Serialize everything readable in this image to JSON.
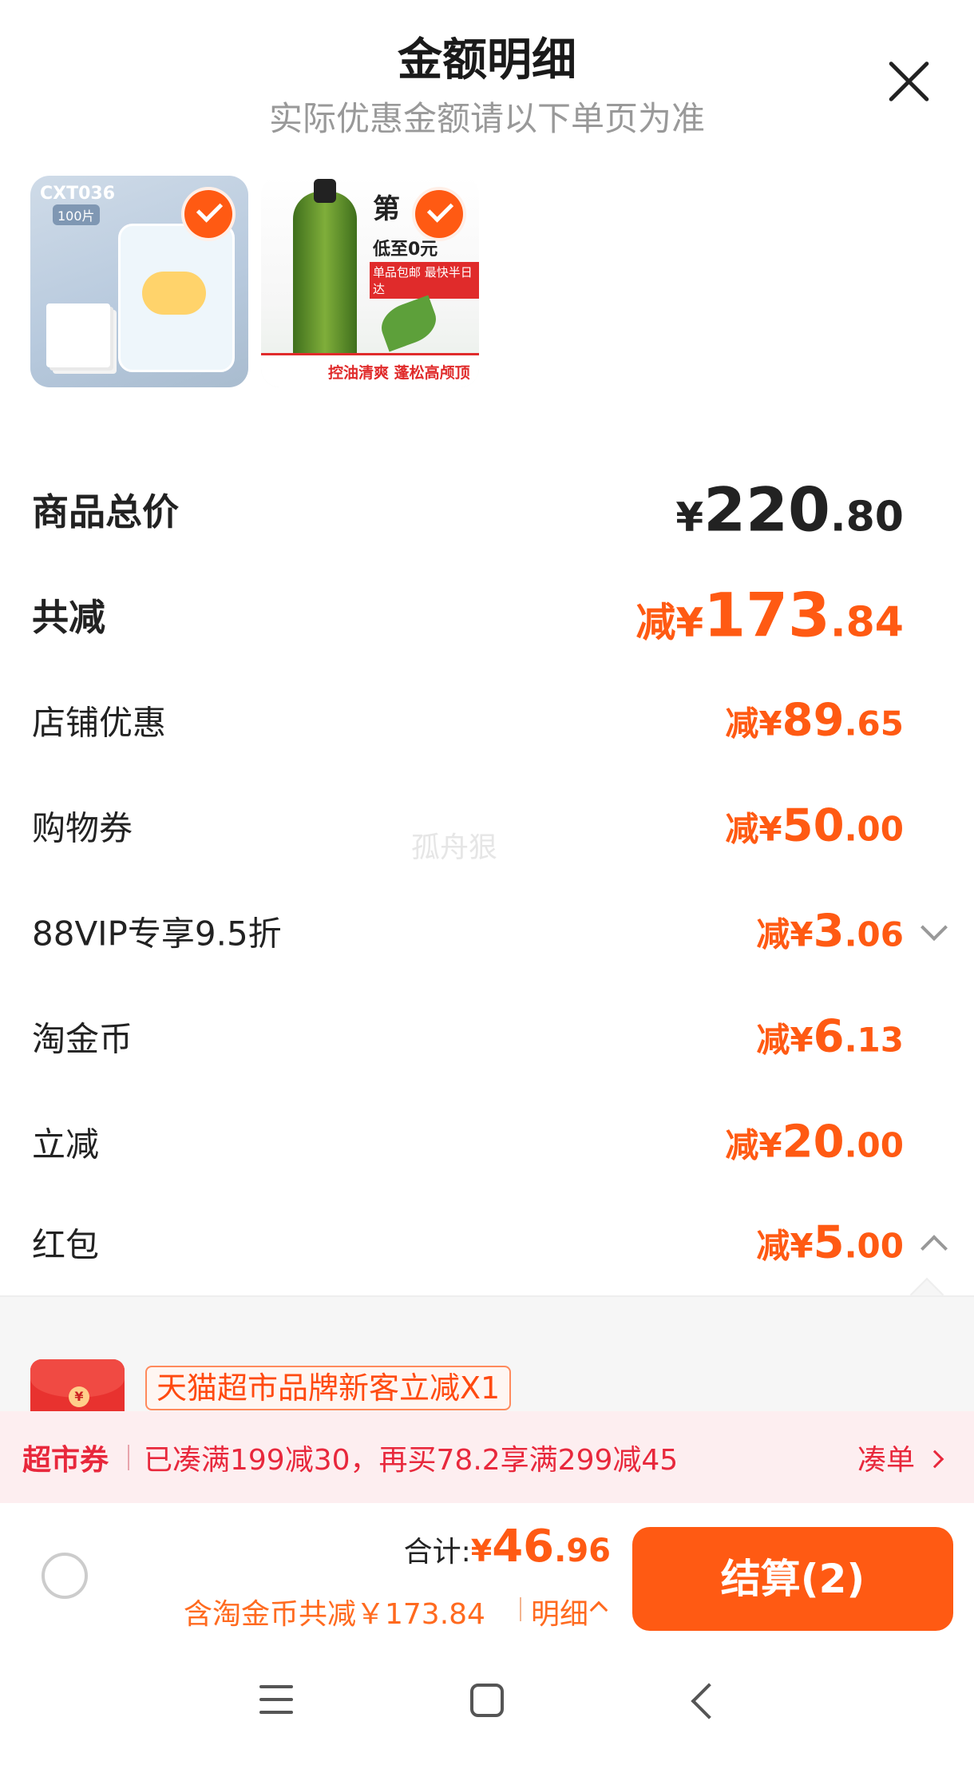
{
  "header": {
    "title": "金额明细",
    "subtitle": "实际优惠金额请以下单页为准"
  },
  "products": [
    {
      "label": "CXT036",
      "sub": "100片",
      "selected": true
    },
    {
      "promo_title": "第",
      "promo_line": "低至0元",
      "promo_tag": "单品包邮 最快半日达",
      "promo_bar": "控油清爽 蓬松高颅顶",
      "selected": true
    }
  ],
  "rows": {
    "total": {
      "label": "商品总价",
      "prefix": "¥",
      "int": "220",
      "dec": ".80"
    },
    "reduction": {
      "label": "共减",
      "prefix": "减¥",
      "int": "173",
      "dec": ".84"
    },
    "shop": {
      "label": "店铺优惠",
      "prefix": "减¥",
      "int": "89",
      "dec": ".65"
    },
    "coupon": {
      "label": "购物券",
      "prefix": "减¥",
      "int": "50",
      "dec": ".00"
    },
    "vip": {
      "label": "88VIP专享9.5折",
      "prefix": "减¥",
      "int": "3",
      "dec": ".06"
    },
    "coins": {
      "label": "淘金币",
      "prefix": "减¥",
      "int": "6",
      "dec": ".13"
    },
    "instant": {
      "label": "立减",
      "prefix": "减¥",
      "int": "20",
      "dec": ".00"
    },
    "redpacket": {
      "label": "红包",
      "prefix": "减¥",
      "int": "5",
      "dec": ".00"
    }
  },
  "watermark": "孤舟狠",
  "redpacket_detail": {
    "tag": "天猫超市品牌新客立减X1",
    "icon_char": "¥"
  },
  "market_bar": {
    "label": "超市券",
    "text": "已凑满199减30，再买78.2享满299减45",
    "link": "凑单"
  },
  "footer": {
    "sum_label": "合计:",
    "sum_prefix": "¥",
    "sum_int": "46",
    "sum_dec": ".96",
    "sub_text": "含淘金币共减￥173.84",
    "detail_link": "明细",
    "checkout": "结算(2)"
  },
  "colors": {
    "accent": "#ff5a13",
    "market_red": "#e8283c",
    "market_bg": "#fdeef0"
  }
}
